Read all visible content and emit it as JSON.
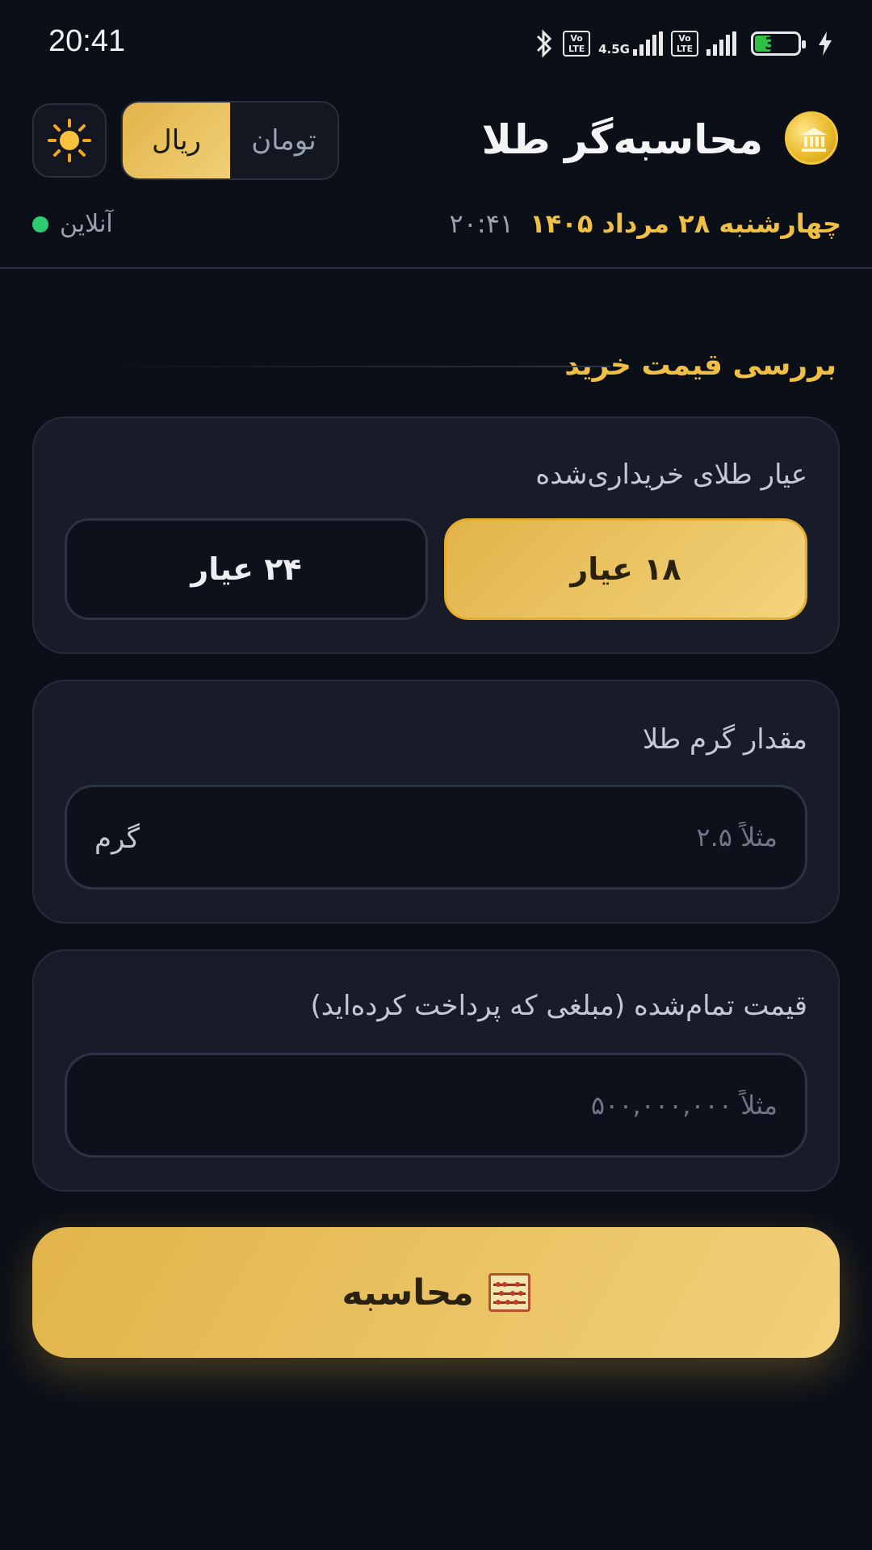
{
  "status_bar": {
    "time": "20:41",
    "volte_label": "Vo\nLTE",
    "network_label": "4.5G",
    "battery_level": "35"
  },
  "header": {
    "app_title": "محاسبه‌گر طلا",
    "currency": {
      "options": [
        "تومان",
        "ریال"
      ],
      "selected": "ریال"
    },
    "date": "چهارشنبه ۲۸ مرداد ۱۴۰۵",
    "time": "۲۰:۴۱",
    "status": "آنلاین"
  },
  "section": {
    "title": "بررسی قیمت خرید"
  },
  "karat_card": {
    "label": "عیار طلای خریداری‌شده",
    "options": [
      "۱۸ عیار",
      "۲۴ عیار"
    ],
    "selected": "۱۸ عیار"
  },
  "weight_card": {
    "label": "مقدار گرم طلا",
    "placeholder": "مثلاً ۲.۵",
    "value": "",
    "unit": "گرم"
  },
  "price_card": {
    "label": "قیمت تمام‌شده (مبلغی که پرداخت کرده‌اید)",
    "placeholder": "مثلاً ۵۰۰,۰۰۰,۰۰۰",
    "value": ""
  },
  "calculate_button": {
    "label": "محاسبه",
    "icon": "abacus-icon"
  },
  "colors": {
    "background": "#0b0f17",
    "card": "#171c28",
    "accent_gold": "#f0bf45",
    "online_green": "#2ecc71"
  }
}
